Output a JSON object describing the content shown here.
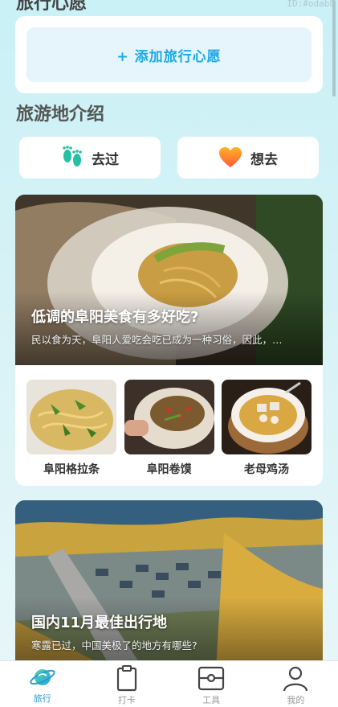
{
  "page": {
    "cut_title": "旅行心愿",
    "watermark": "ID:#odab8"
  },
  "wish": {
    "add_label": "+ 添加旅行心愿"
  },
  "section": {
    "title": "旅游地介绍"
  },
  "buttons": {
    "visited": "去过",
    "want": "想去"
  },
  "feature": {
    "title": "低调的阜阳美食有多好吃?",
    "subtitle": "民以食为天，阜阳人爱吃会吃已成为一种习俗，因此，…",
    "items": [
      {
        "label": "阜阳格拉条"
      },
      {
        "label": "阜阳卷馍"
      },
      {
        "label": "老母鸡汤"
      }
    ]
  },
  "feature2": {
    "title": "国内11月最佳出行地",
    "subtitle": "寒露已过，中国美极了的地方有哪些?"
  },
  "tabbar": {
    "items": [
      {
        "label": "旅行",
        "active": true
      },
      {
        "label": "打卡",
        "active": false
      },
      {
        "label": "工具",
        "active": false
      },
      {
        "label": "我的",
        "active": false
      }
    ]
  },
  "colors": {
    "accent": "#1ea8e4",
    "tab_active": "#2c9ad6",
    "background_top": "#c9f1f6"
  }
}
